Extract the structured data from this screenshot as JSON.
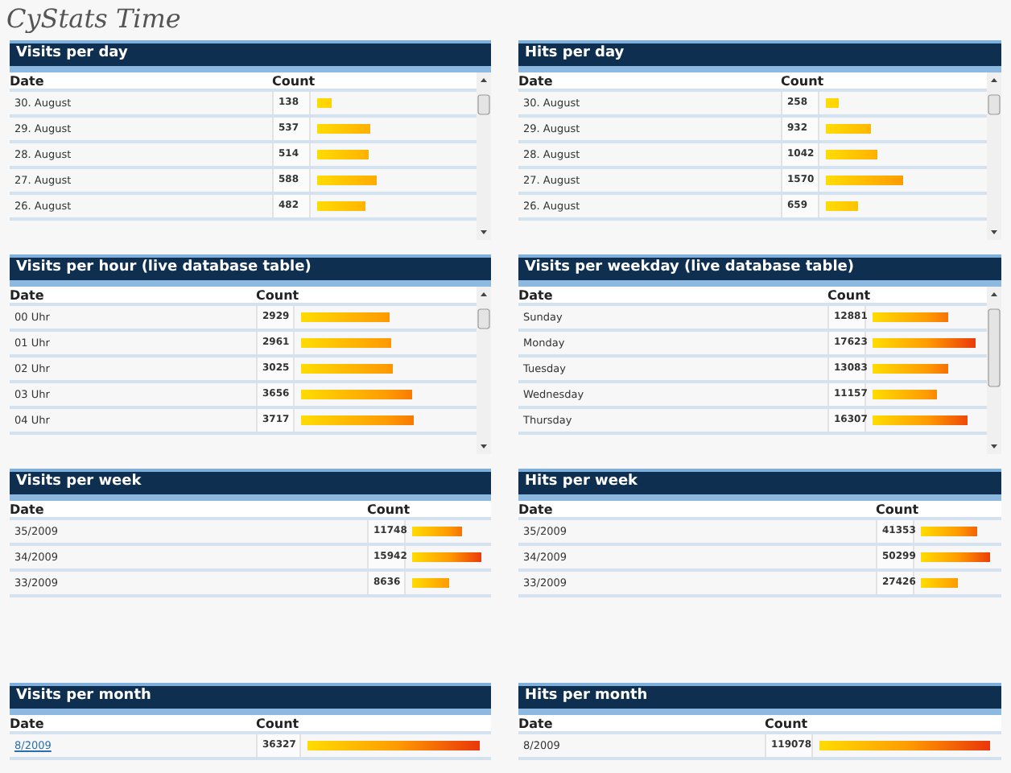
{
  "title": "CyStats Time",
  "panels": [
    {
      "title": "Visits per day",
      "scrollable": true,
      "columns": [
        "Date",
        "Count"
      ],
      "rows": [
        {
          "date": "30. August",
          "count": "138"
        },
        {
          "date": "29. August",
          "count": "537"
        },
        {
          "date": "28. August",
          "count": "514"
        },
        {
          "date": "27. August",
          "count": "588"
        },
        {
          "date": "26. August",
          "count": "482"
        }
      ]
    },
    {
      "title": "Hits per day",
      "scrollable": true,
      "columns": [
        "Date",
        "Count"
      ],
      "rows": [
        {
          "date": "30. August",
          "count": "258"
        },
        {
          "date": "29. August",
          "count": "932"
        },
        {
          "date": "28. August",
          "count": "1042"
        },
        {
          "date": "27. August",
          "count": "1570"
        },
        {
          "date": "26. August",
          "count": "659"
        }
      ]
    },
    {
      "title": "Visits per hour (live database table)",
      "scrollable": true,
      "columns": [
        "Date",
        "Count"
      ],
      "rows": [
        {
          "date": "00 Uhr",
          "count": "2929"
        },
        {
          "date": "01 Uhr",
          "count": "2961"
        },
        {
          "date": "02 Uhr",
          "count": "3025"
        },
        {
          "date": "03 Uhr",
          "count": "3656"
        },
        {
          "date": "04 Uhr",
          "count": "3717"
        }
      ]
    },
    {
      "title": "Visits per weekday (live database table)",
      "scrollable": true,
      "columns": [
        "Date",
        "Count"
      ],
      "rows": [
        {
          "date": "Sunday",
          "count": "12881"
        },
        {
          "date": "Monday",
          "count": "17623"
        },
        {
          "date": "Tuesday",
          "count": "13083"
        },
        {
          "date": "Wednesday",
          "count": "11157"
        },
        {
          "date": "Thursday",
          "count": "16307"
        }
      ]
    },
    {
      "title": "Visits per week",
      "scrollable": false,
      "columns": [
        "Date",
        "Count"
      ],
      "rows": [
        {
          "date": "35/2009",
          "count": "11748"
        },
        {
          "date": "34/2009",
          "count": "15942"
        },
        {
          "date": "33/2009",
          "count": "8636"
        }
      ]
    },
    {
      "title": "Hits per week",
      "scrollable": false,
      "columns": [
        "Date",
        "Count"
      ],
      "rows": [
        {
          "date": "35/2009",
          "count": "41353"
        },
        {
          "date": "34/2009",
          "count": "50299"
        },
        {
          "date": "33/2009",
          "count": "27426"
        }
      ]
    },
    {
      "title": "Visits per month",
      "scrollable": false,
      "columns": [
        "Date",
        "Count"
      ],
      "rows": [
        {
          "date": "8/2009",
          "count": "36327",
          "linked": true
        }
      ]
    },
    {
      "title": "Hits per month",
      "scrollable": false,
      "columns": [
        "Date",
        "Count"
      ],
      "rows": [
        {
          "date": "8/2009",
          "count": "119078",
          "linked": false
        }
      ]
    }
  ]
}
